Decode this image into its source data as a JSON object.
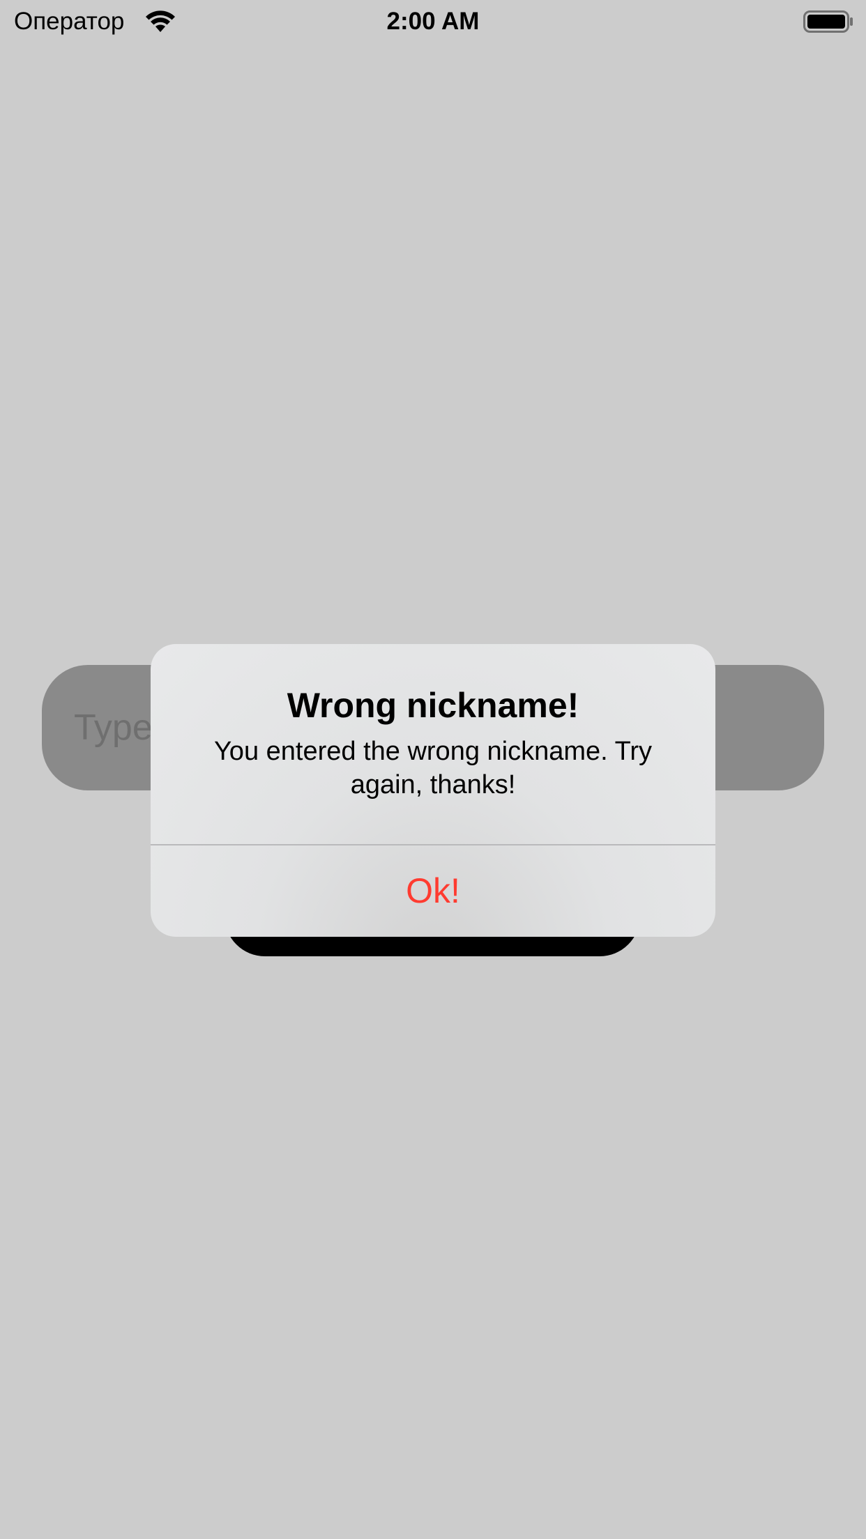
{
  "status_bar": {
    "carrier": "Оператор",
    "time": "2:00 AM",
    "wifi_icon": "wifi-icon",
    "battery_icon": "battery-full-icon"
  },
  "screen": {
    "nickname_input": {
      "placeholder": "Type your nickname",
      "value": ""
    }
  },
  "alert": {
    "title": "Wrong nickname!",
    "message": "You entered the wrong nickname. Try again, thanks!",
    "action_label": "Ok!",
    "action_color": "#ff3b30"
  },
  "colors": {
    "background": "#cccccc",
    "input_fill": "#8a8a8a",
    "button_fill": "#000000"
  }
}
